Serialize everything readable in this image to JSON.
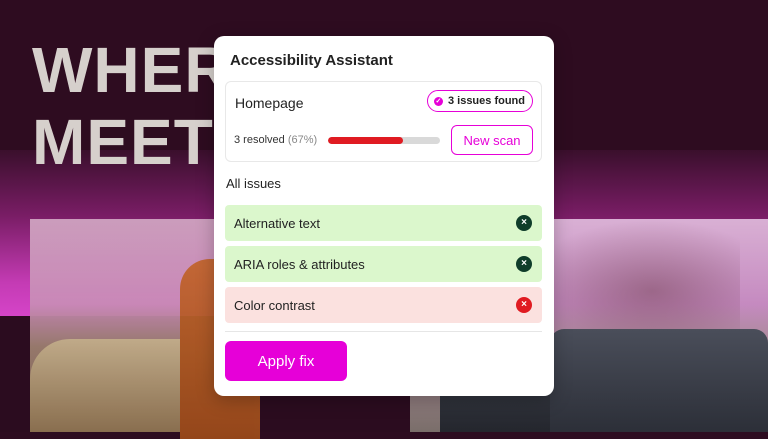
{
  "background": {
    "headline_line1": "WHERE STYLES",
    "headline_line2": "MEET"
  },
  "panel": {
    "title": "Accessibility Assistant",
    "summary": {
      "page_name": "Homepage",
      "issues_badge": "3 issues found",
      "resolved_label": "3 resolved",
      "resolved_pct": "(67%)",
      "progress_fraction": 0.67,
      "scan_button": "New scan"
    },
    "section_label": "All issues",
    "issues": [
      {
        "label": "Alternative text",
        "status": "pass"
      },
      {
        "label": "ARIA roles & attributes",
        "status": "pass"
      },
      {
        "label": "Color contrast",
        "status": "fail"
      }
    ],
    "fix_button": "Apply fix"
  },
  "colors": {
    "accent": "#e600d8",
    "progress": "#e01b22",
    "pass_bg": "#dbf7cc",
    "fail_bg": "#fbe1df",
    "pass_icon": "#0f3d2a",
    "fail_icon": "#e01b22"
  },
  "icons": {
    "badge": "check-circle-icon",
    "pass": "close-circle-icon",
    "fail": "close-circle-icon"
  }
}
